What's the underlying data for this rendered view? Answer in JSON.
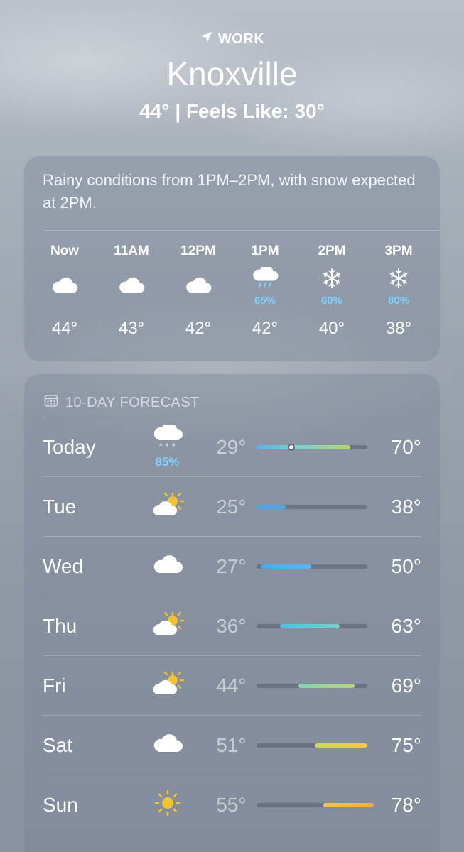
{
  "header": {
    "location_label": "WORK",
    "city": "Knoxville",
    "temps": "44°  |  Feels Like: 30°"
  },
  "hourly": {
    "summary": "Rainy conditions from 1PM–2PM, with snow expected at 2PM.",
    "hours": [
      {
        "label": "Now",
        "icon": "cloud-icon",
        "precip": "",
        "temp": "44°"
      },
      {
        "label": "11AM",
        "icon": "cloud-icon",
        "precip": "",
        "temp": "43°"
      },
      {
        "label": "12PM",
        "icon": "cloud-icon",
        "precip": "",
        "temp": "42°"
      },
      {
        "label": "1PM",
        "icon": "cloud-rain-icon",
        "precip": "65%",
        "temp": "42°"
      },
      {
        "label": "2PM",
        "icon": "snowflake-icon",
        "precip": "60%",
        "temp": "40°"
      },
      {
        "label": "3PM",
        "icon": "snowflake-icon",
        "precip": "80%",
        "temp": "38°"
      }
    ]
  },
  "forecast": {
    "title": "10-DAY FORECAST",
    "days": [
      {
        "day": "Today",
        "icon": "cloud-snow-icon",
        "precip": "85%",
        "low": "29°",
        "high": "70°",
        "bar_start": 0.0,
        "bar_end": 0.8,
        "current": 0.3,
        "colors": [
          "#5ab4ea",
          "#7fd0c9",
          "#b6d66a"
        ]
      },
      {
        "day": "Tue",
        "icon": "partly-sunny-icon",
        "precip": "",
        "low": "25°",
        "high": "38°",
        "bar_start": 0.0,
        "bar_end": 0.25,
        "colors": [
          "#4aa8ec",
          "#4aa8ec"
        ]
      },
      {
        "day": "Wed",
        "icon": "cloud-icon",
        "precip": "",
        "low": "27°",
        "high": "50°",
        "bar_start": 0.04,
        "bar_end": 0.47,
        "colors": [
          "#4aa8ec",
          "#5ab8ec"
        ]
      },
      {
        "day": "Thu",
        "icon": "partly-sunny-icon",
        "precip": "",
        "low": "36°",
        "high": "63°",
        "bar_start": 0.2,
        "bar_end": 0.71,
        "colors": [
          "#58bde5",
          "#79d2c8"
        ]
      },
      {
        "day": "Fri",
        "icon": "partly-sunny-icon",
        "precip": "",
        "low": "44°",
        "high": "69°",
        "bar_start": 0.36,
        "bar_end": 0.84,
        "colors": [
          "#86d2b9",
          "#b5d774"
        ]
      },
      {
        "day": "Sat",
        "icon": "cloud-icon",
        "precip": "",
        "low": "51°",
        "high": "75°",
        "bar_start": 0.5,
        "bar_end": 0.95,
        "colors": [
          "#c9d65f",
          "#f3c64a"
        ]
      },
      {
        "day": "Sun",
        "icon": "sun-icon",
        "precip": "",
        "low": "55°",
        "high": "78°",
        "bar_start": 0.57,
        "bar_end": 1.0,
        "colors": [
          "#efc648",
          "#f0a840"
        ]
      }
    ]
  }
}
